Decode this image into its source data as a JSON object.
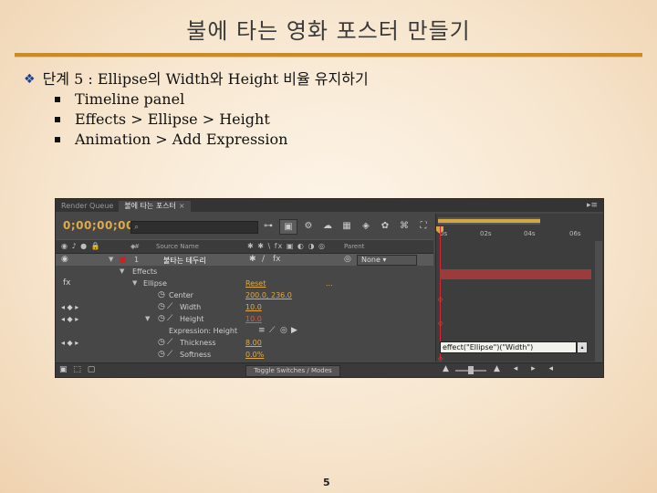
{
  "slide": {
    "title": "불에 타는 영화 포스터 만들기",
    "step": "단계 5 : Ellipse의 Width와 Height 비율 유지하기",
    "bullets": [
      "Timeline panel",
      "Effects > Ellipse > Height",
      "Animation > Add Expression"
    ],
    "page_number": "5"
  },
  "ae": {
    "tabs": [
      "Render Queue",
      "불에 타는 포스터"
    ],
    "timecode": "0;00;00;00",
    "columns": {
      "source_name": "Source Name",
      "parent": "Parent"
    },
    "layer": {
      "index": "1",
      "name": "불타는 테두리",
      "parent_value": "None"
    },
    "effects_label": "Effects",
    "ellipse_label": "Ellipse",
    "reset_label": "Reset",
    "about_label": "...",
    "props": [
      {
        "name": "Center",
        "value": "200.0, 236.0"
      },
      {
        "name": "Width",
        "value": "10.0"
      },
      {
        "name": "Height",
        "value": "10.0"
      },
      {
        "name": "Expression: Height",
        "value": ""
      },
      {
        "name": "Thickness",
        "value": "8.00"
      },
      {
        "name": "Softness",
        "value": "0.0%"
      }
    ],
    "ruler_ticks": [
      "0s",
      "02s",
      "04s",
      "06s"
    ],
    "expression": "effect(\"Ellipse\")(\"Width\")",
    "toggle_label": "Toggle Switches / Modes"
  },
  "colors": {
    "accent_rule": "#c98a2a",
    "bullet_diamond": "#1d3f91",
    "timecode": "#e0aa4a",
    "layer_bar": "#9b3b3b",
    "keyframe_red": "#e35b3b"
  }
}
